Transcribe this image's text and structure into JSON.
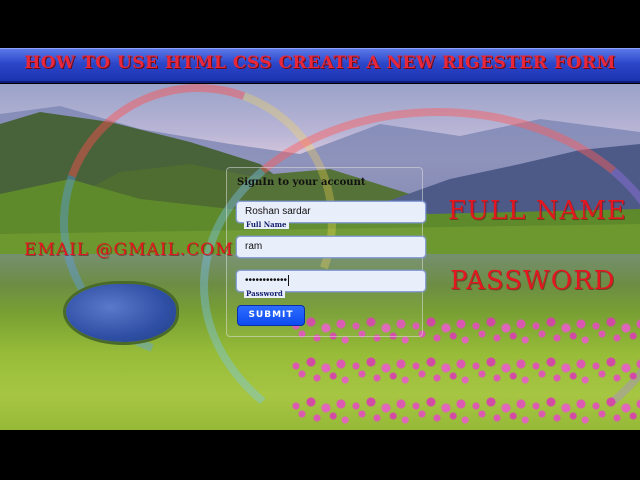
{
  "title": "HOW TO USE HTML CSS CREATE A NEW RIGESTER FORM",
  "form": {
    "heading": "SignIn to your account",
    "full_name_value": "Roshan sardar",
    "full_name_label": "Full Name",
    "email_value": "ram",
    "password_value": "••••••••••••",
    "password_label": "Password",
    "submit_label": "SUBMIT"
  },
  "overlay_labels": {
    "full_name": "FULL NAME",
    "email": "EMAIL @GMAIL.COM",
    "password": "PASSWORD"
  },
  "colors": {
    "title_bar": "#2c46c9",
    "title_text": "#e8283a",
    "overlay_text": "#e4161f",
    "submit_button": "#0d4cf0",
    "input_background": "#e9eefb"
  }
}
